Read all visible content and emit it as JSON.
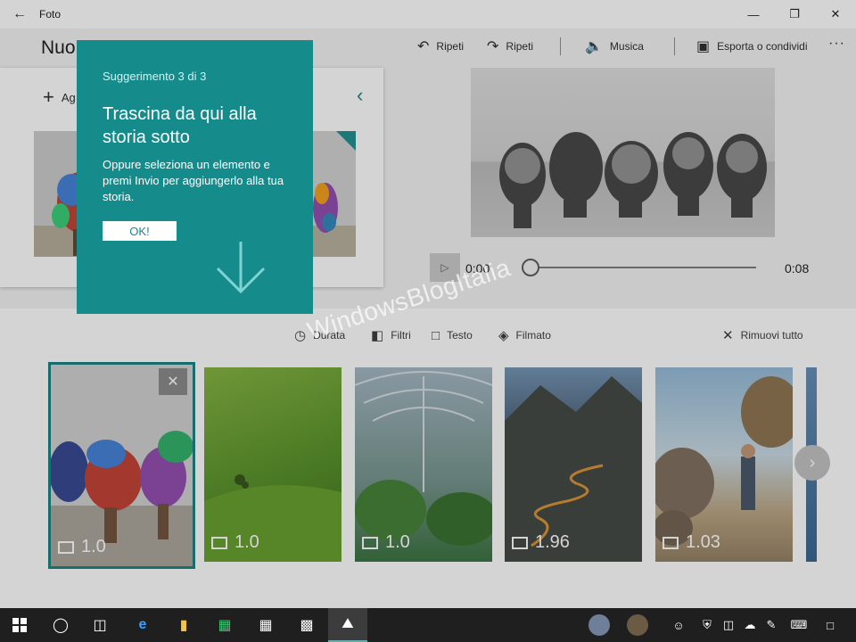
{
  "window": {
    "title": "Foto"
  },
  "command_bar": {
    "project_title": "Nuo",
    "undo": "Ripeti",
    "redo": "Ripeti",
    "music": "Musica",
    "export": "Esporta o condividi"
  },
  "library": {
    "add_label": "Ag"
  },
  "preview": {
    "time_current": "0:00",
    "time_total": "0:08",
    "progress": 0
  },
  "storyboard": {
    "tools": {
      "duration": "Durata",
      "filters": "Filtri",
      "text": "Testo",
      "motion": "Filmato",
      "remove_all": "Rimuovi tutto"
    },
    "cards": [
      {
        "duration": "1.0",
        "selected": true
      },
      {
        "duration": "1.0"
      },
      {
        "duration": "1.0"
      },
      {
        "duration": "1.96"
      },
      {
        "duration": "1.03"
      }
    ]
  },
  "teaching_tip": {
    "step": "Suggerimento 3 di 3",
    "title": "Trascina da qui alla storia sotto",
    "body": "Oppure seleziona un elemento e premi Invio per aggiungerlo alla tua storia.",
    "ok": "OK!"
  },
  "watermark": "WindowsBlogItalia",
  "colors": {
    "accent": "#158b8b",
    "selection": "#0e7b7b",
    "taskbar": "#1f1f1f"
  }
}
